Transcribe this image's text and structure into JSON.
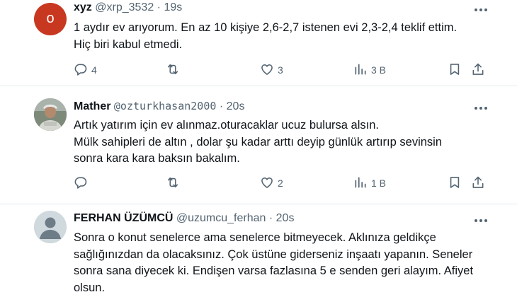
{
  "tweets": [
    {
      "avatar_initial": "o",
      "avatar_color": "#c8371f",
      "name": "xyz",
      "handle": "@xrp_3532",
      "separator": "·",
      "time": "19s",
      "lines": [
        "1 aydır ev arıyorum. En az 10 kişiye 2,6-2,7 istenen evi 2,3-2,4 teklif ettim.",
        "Hiç biri kabul etmedi."
      ],
      "replies": "4",
      "retweets": "",
      "likes": "3",
      "views": "3 B"
    },
    {
      "name": "Mather",
      "handle": "@ozturkhasan2000",
      "separator": "·",
      "time": "20s",
      "lines": [
        "Artık yatırım için ev alınmaz.oturacaklar ucuz bulursa alsın.",
        "Mülk sahipleri de altın , dolar şu kadar arttı deyip günlük artırıp sevinsin",
        "sonra kara kara baksın bakalım."
      ],
      "replies": "",
      "retweets": "",
      "likes": "2",
      "views": "1 B"
    },
    {
      "name": "FERHAN ÜZÜMCÜ",
      "handle": "@uzumcu_ferhan",
      "separator": "·",
      "time": "20s",
      "lines": [
        "Sonra  o  konut senelerce ama senelerce bitmeyecek. Aklınıza geldikçe",
        "sağlığınızdan da olacaksınız. Çok üstüne giderseniz inşaatı yapanın. Seneler",
        "sonra sana diyecek ki. Endişen varsa fazlasına 5 e senden geri alayım. Afiyet",
        "olsun."
      ]
    }
  ],
  "colors": {
    "text": "#0f1419",
    "secondary": "#536471",
    "divider": "#e4e7ea"
  },
  "icons": [
    "reply-icon",
    "retweet-icon",
    "like-icon",
    "views-icon",
    "bookmark-icon",
    "share-icon",
    "more-icon",
    "default-avatar-icon"
  ]
}
